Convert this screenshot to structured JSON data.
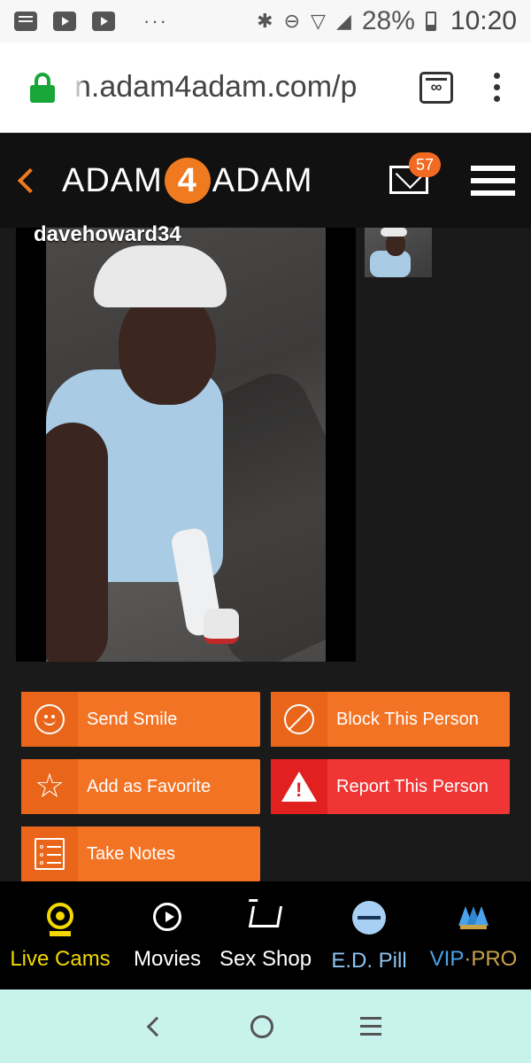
{
  "status_bar": {
    "battery": "28%",
    "time": "10:20",
    "overflow": "···",
    "icons": [
      "message-icon",
      "youtube-icon",
      "youtube-icon",
      "bluetooth-icon",
      "dnd-icon",
      "wifi-icon",
      "signal-icon",
      "battery-icon"
    ]
  },
  "browser": {
    "url": "n.adam4adam.com/p",
    "tab_count": "∞"
  },
  "header": {
    "logo_left": "ADAM",
    "logo_mid": "4",
    "logo_right": "ADAM",
    "mail_badge": "57",
    "accent_color": "#f07a20"
  },
  "profile": {
    "username": "davehoward34"
  },
  "actions": [
    {
      "label": "Send Smile",
      "icon": "smile-icon",
      "color": "#f37324"
    },
    {
      "label": "Block This Person",
      "icon": "block-icon",
      "color": "#f37324"
    },
    {
      "label": "Add as Favorite",
      "icon": "star-icon",
      "color": "#f37324"
    },
    {
      "label": "Report This Person",
      "icon": "warning-icon",
      "color": "#f03535"
    },
    {
      "label": "Take Notes",
      "icon": "notes-icon",
      "color": "#f37324"
    }
  ],
  "bottom_nav": [
    {
      "label": "Live Cams",
      "icon": "webcam-icon",
      "color": "#f2d800"
    },
    {
      "label": "Movies",
      "icon": "play-icon",
      "color": "#ffffff"
    },
    {
      "label": "Sex Shop",
      "icon": "cart-icon",
      "color": "#ffffff"
    },
    {
      "label": "E.D. Pill",
      "icon": "pill-icon",
      "color": "#8ec4f2"
    },
    {
      "label_vip": "VIP",
      "label_dot": "·",
      "label_pro": "PRO",
      "icon": "crown-icon",
      "color_vip": "#4ba3ea",
      "color_pro": "#c9a24a"
    }
  ]
}
